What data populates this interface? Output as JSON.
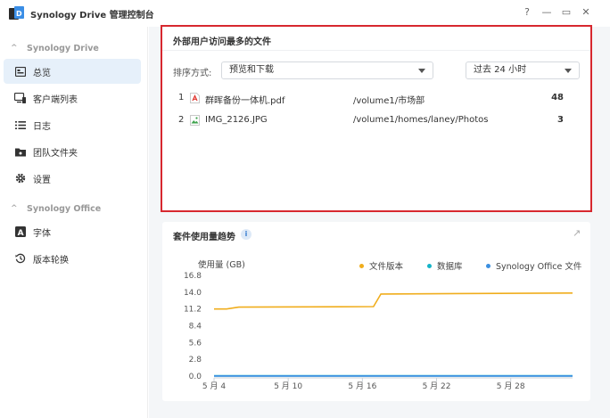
{
  "window": {
    "title": "Synology Drive 管理控制台",
    "help": "?",
    "minimize": "—",
    "maximize": "▭",
    "close": "✕"
  },
  "sidebar": {
    "sections": [
      {
        "label": "Synology Drive"
      },
      {
        "label": "Synology Office"
      }
    ],
    "items": [
      {
        "label": "总览",
        "icon": "dashboard-icon",
        "active": true
      },
      {
        "label": "客户端列表",
        "icon": "monitor-icon"
      },
      {
        "label": "日志",
        "icon": "list-icon"
      },
      {
        "label": "团队文件夹",
        "icon": "folder-icon"
      },
      {
        "label": "设置",
        "icon": "gear-icon"
      },
      {
        "label": "字体",
        "icon": "font-icon"
      },
      {
        "label": "版本轮换",
        "icon": "history-icon"
      }
    ]
  },
  "top_files": {
    "title": "外部用户访问最多的文件",
    "sort_label": "排序方式:",
    "sort_value": "预览和下载",
    "range_value": "过去 24 小时",
    "rows": [
      {
        "rank": "1",
        "name": "群晖备份一体机.pdf",
        "path": "/volume1/市场部",
        "count": "48",
        "type": "pdf"
      },
      {
        "rank": "2",
        "name": "IMG_2126.JPG",
        "path": "/volume1/homes/laney/Photos",
        "count": "3",
        "type": "image"
      }
    ]
  },
  "trend": {
    "title": "套件使用量趋势",
    "info": "i",
    "expand": "↗"
  },
  "chart_data": {
    "type": "line",
    "ylabel": "使用量 (GB)",
    "yticks": [
      "16.8",
      "14.0",
      "11.2",
      "8.4",
      "5.6",
      "2.8",
      "0.0"
    ],
    "ylim": [
      0,
      16.8
    ],
    "xticks": [
      "5 月 4",
      "5 月 10",
      "5 月 16",
      "5 月 22",
      "5 月 28"
    ],
    "xtick_days": [
      4,
      10,
      16,
      22,
      28
    ],
    "xlim": [
      4,
      33
    ],
    "series": [
      {
        "name": "文件版本",
        "color": "#f0ad1c",
        "x": [
          4,
          5,
          6,
          16.9,
          17.5,
          33
        ],
        "y": [
          11.2,
          11.2,
          11.5,
          11.6,
          13.7,
          13.85
        ]
      },
      {
        "name": "数据库",
        "color": "#15b4c8",
        "x": [
          4,
          33
        ],
        "y": [
          0.05,
          0.05
        ]
      },
      {
        "name": "Synology Office 文件",
        "color": "#3b8fe0",
        "x": [
          4,
          33
        ],
        "y": [
          0.02,
          0.02
        ]
      }
    ],
    "grid": false,
    "legend": "top-right"
  }
}
